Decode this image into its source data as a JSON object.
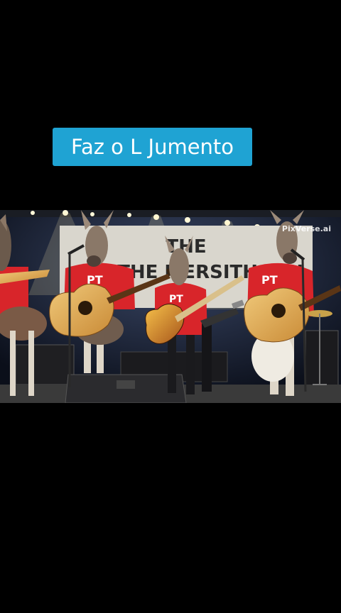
{
  "caption": {
    "text": "Faz o L Jumento"
  },
  "video": {
    "watermark": "PixVerse.ai",
    "banner_text": "THE MERSITHORN",
    "shirt_text": "PT",
    "colors": {
      "caption_bg": "#1fa3d3",
      "shirt": "#d8252a",
      "stage": "#3a3a3a"
    }
  }
}
